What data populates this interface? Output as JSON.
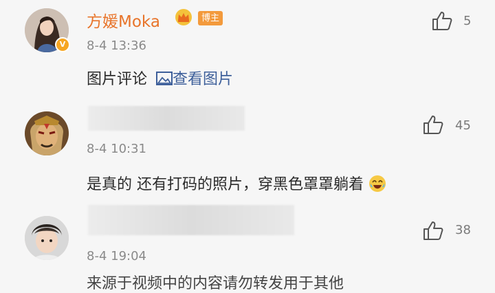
{
  "comments": [
    {
      "name": "方媛Moka",
      "badge": "博主",
      "verified_mark": "V",
      "time": "8-4 13:36",
      "text_prefix": "图片评论",
      "link_text": "查看图片",
      "likes": "5",
      "avatar_icon": "woman-portrait-avatar"
    },
    {
      "name": "",
      "time": "8-4 10:31",
      "text": "是真的 还有打码的照片，穿黑色罩罩躺着",
      "emoji": "laughing-tears-emoji",
      "likes": "45",
      "avatar_icon": "painted-opera-face-avatar"
    },
    {
      "name": "",
      "time": "8-4 19:04",
      "text_partial": "来源于视频中的内容请勿转发用于其他",
      "likes": "38",
      "avatar_icon": "young-man-avatar"
    }
  ],
  "colors": {
    "name_orange": "#e8742a",
    "link_blue": "#3d5f9a",
    "badge_orange": "#f39a3c",
    "background": "#f6f6f6"
  }
}
